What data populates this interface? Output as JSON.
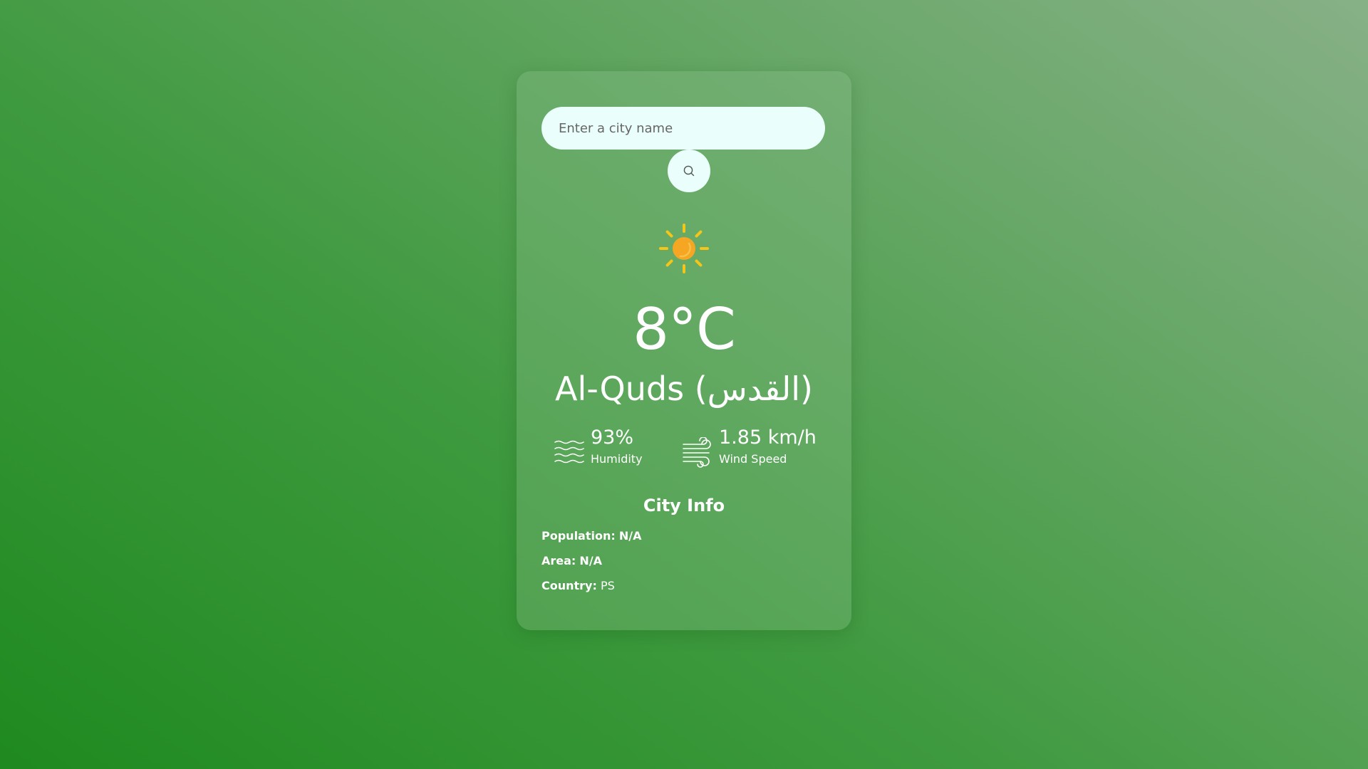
{
  "search": {
    "placeholder": "Enter a city name",
    "value": ""
  },
  "weather": {
    "icon": "sun-icon",
    "temperature": "8°C",
    "city": "Al-Quds (القدس)"
  },
  "details": {
    "humidity": {
      "value": "93%",
      "label": "Humidity",
      "icon": "humidity-waves-icon"
    },
    "wind": {
      "value": "1.85 km/h",
      "label": "Wind Speed",
      "icon": "wind-icon"
    }
  },
  "city_info": {
    "title": "City Info",
    "population_label": "Population:",
    "population_value": "N/A",
    "area_label": "Area:",
    "area_value": "N/A",
    "country_label": "Country:",
    "country_value": "PS"
  },
  "colors": {
    "background_start": "#1f8a1f",
    "background_end": "#87b087",
    "input_bg": "#eafffb",
    "sun_core": "#f5a623",
    "sun_rays": "#f5c518"
  }
}
